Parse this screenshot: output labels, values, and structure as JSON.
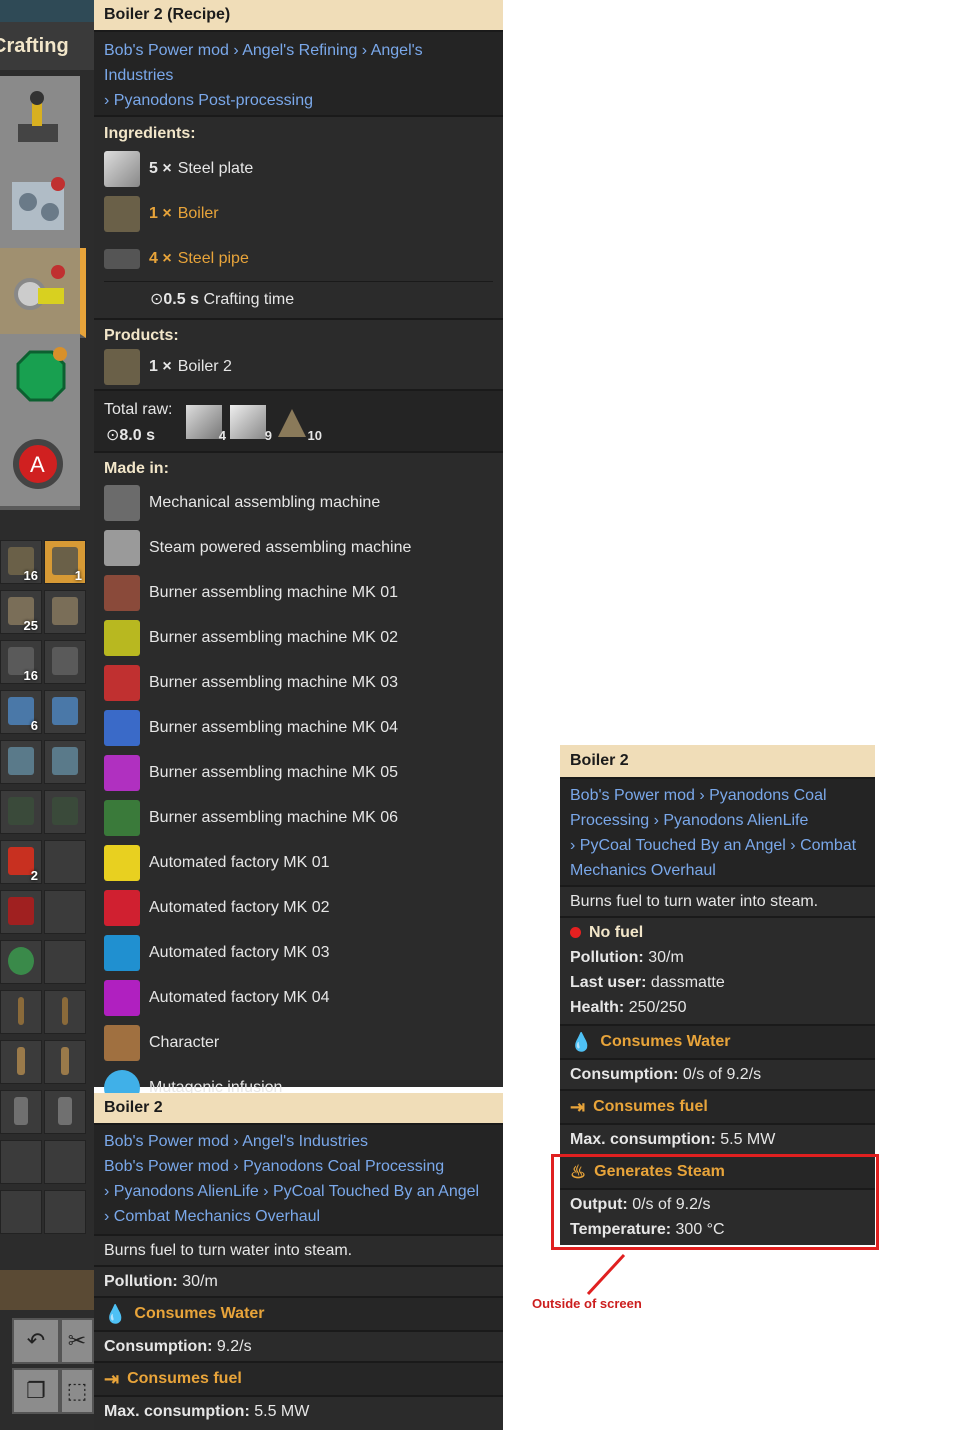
{
  "strip": {
    "title": "Crafting",
    "counts": [
      "16",
      "1",
      "25",
      "16",
      "6",
      "2"
    ]
  },
  "recipe_panel": {
    "header": "Boiler 2 (Recipe)",
    "mods": [
      "Bob's Power mod",
      "Angel's Refining",
      "Angel's Industries",
      "Pyanodons Post-processing"
    ],
    "ingredients_label": "Ingredients:",
    "ingredients": [
      {
        "qty": "5 ×",
        "name": "Steel plate",
        "icon": "steel-plate-icon",
        "highlight": false
      },
      {
        "qty": "1 ×",
        "name": "Boiler",
        "icon": "boiler-icon",
        "highlight": true
      },
      {
        "qty": "4 ×",
        "name": "Steel pipe",
        "icon": "steel-pipe-icon",
        "highlight": true
      }
    ],
    "crafting_time_value": "0.5 s",
    "crafting_time_label": "Crafting time",
    "products_label": "Products:",
    "product": {
      "qty": "1 ×",
      "name": "Boiler 2",
      "icon": "boiler-2-icon"
    },
    "total_raw_label": "Total raw:",
    "total_raw_time": "8.0 s",
    "total_raw_counts": [
      "4",
      "9",
      "10"
    ],
    "made_in_label": "Made in:",
    "made_in": [
      {
        "name": "Mechanical assembling machine",
        "color": "#6b6b6b"
      },
      {
        "name": "Steam powered assembling machine",
        "color": "#9a9a9a"
      },
      {
        "name": "Burner assembling machine MK 01",
        "color": "#8a4a3a"
      },
      {
        "name": "Burner assembling machine MK 02",
        "color": "#b8b820"
      },
      {
        "name": "Burner assembling machine MK 03",
        "color": "#c03030"
      },
      {
        "name": "Burner assembling machine MK 04",
        "color": "#3a6ac8"
      },
      {
        "name": "Burner assembling machine MK 05",
        "color": "#b030c0"
      },
      {
        "name": "Burner assembling machine MK 06",
        "color": "#3a7a3a"
      },
      {
        "name": "Automated factory MK 01",
        "color": "#e8d020"
      },
      {
        "name": "Automated factory MK 02",
        "color": "#d02030"
      },
      {
        "name": "Automated factory MK 03",
        "color": "#2090d0"
      },
      {
        "name": "Automated factory MK 04",
        "color": "#b020c0"
      },
      {
        "name": "Character",
        "color": "#a07040"
      },
      {
        "name": "Mutagenic infusion",
        "color": "#40b0e8"
      }
    ]
  },
  "entity_panel": {
    "header": "Boiler 2",
    "mod_lines": [
      [
        "Bob's Power mod",
        "Angel's Industries"
      ],
      [
        "Bob's Power mod",
        "Pyanodons Coal Processing"
      ],
      [
        "Pyanodons AlienLife",
        "PyCoal Touched By an Angel"
      ],
      [
        "Combat Mechanics Overhaul"
      ]
    ],
    "description": "Burns fuel to turn water into steam.",
    "pollution_label": "Pollution:",
    "pollution_value": "30/m",
    "water_title": "Consumes Water",
    "consumption_label": "Consumption:",
    "consumption_value": "9.2/s",
    "fuel_title": "Consumes fuel",
    "max_consumption_label": "Max. consumption:",
    "max_consumption_value": "5.5 MW"
  },
  "live_panel": {
    "header": "Boiler 2",
    "mod_text_1": "Bob's Power mod",
    "mod_text_2": "Pyanodons Coal",
    "mod_text_3": "Processing",
    "mod_text_4": "Pyanodons AlienLife",
    "mod_text_5": "PyCoal Touched By an Angel",
    "mod_text_6": "Combat",
    "mod_text_7": "Mechanics Overhaul",
    "description": "Burns fuel to turn water into steam.",
    "status": "No fuel",
    "pollution_label": "Pollution:",
    "pollution_value": "30/m",
    "last_user_label": "Last user:",
    "last_user_value": "dassmatte",
    "health_label": "Health:",
    "health_value": "250/250",
    "water_title": "Consumes Water",
    "consumption_label": "Consumption:",
    "consumption_value": "0/s of 9.2/s",
    "fuel_title": "Consumes fuel",
    "max_consumption_label": "Max. consumption:",
    "max_consumption_value": "5.5 MW",
    "steam_title": "Generates Steam",
    "output_label": "Output:",
    "output_value": "0/s of 9.2/s",
    "temperature_label": "Temperature:",
    "temperature_value": "300 °C"
  },
  "annotation": {
    "text": "Outside of screen",
    "color": "#cc1e1e"
  }
}
